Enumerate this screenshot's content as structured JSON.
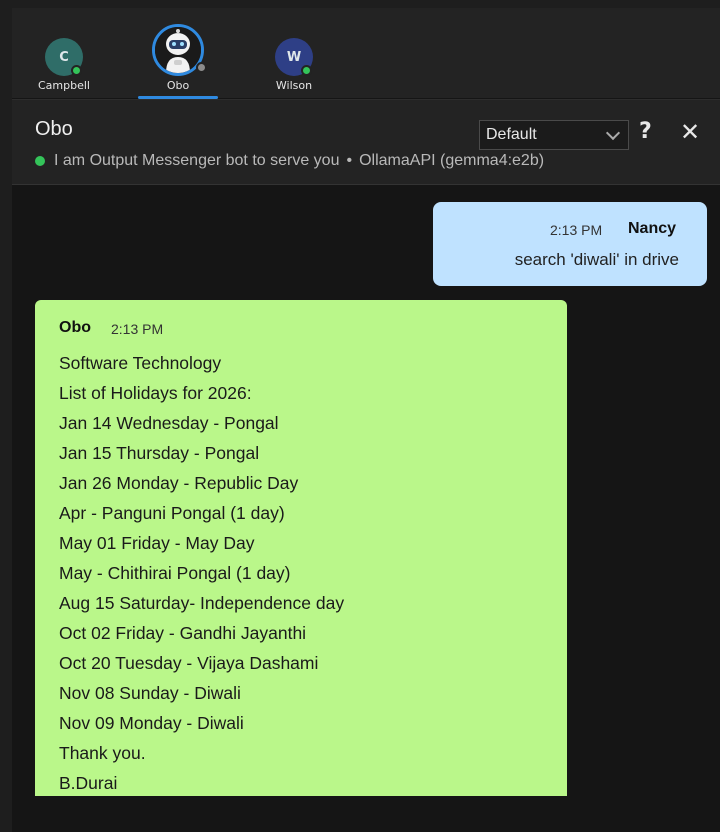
{
  "tabs": [
    {
      "name": "Campbell",
      "initial": "C",
      "status": "online"
    },
    {
      "name": "Obo",
      "status": "away"
    },
    {
      "name": "Wilson",
      "initial": "W",
      "status": "online"
    }
  ],
  "header": {
    "title": "Obo",
    "status_text": "I am Output Messenger bot to serve you",
    "separator": "•",
    "model": "OllamaAPI (gemma4:e2b)",
    "select_value": "Default",
    "help": "?",
    "close": "✕"
  },
  "messages": {
    "outgoing": {
      "time": "2:13 PM",
      "sender": "Nancy",
      "text": "search 'diwali' in drive"
    },
    "incoming": {
      "sender": "Obo",
      "time": "2:13 PM",
      "lines": [
        "Software Technology",
        "List of Holidays for 2026:",
        "Jan 14 Wednesday - Pongal",
        "Jan 15 Thursday - Pongal",
        "Jan 26 Monday - Republic Day",
        "Apr - Panguni Pongal (1 day)",
        "May 01 Friday - May Day",
        "May - Chithirai Pongal (1 day)",
        "Aug 15 Saturday- Independence day",
        "Oct 02 Friday - Gandhi Jayanthi",
        "Oct 20 Tuesday - Vijaya Dashami",
        "Nov 08 Sunday - Diwali",
        "Nov 09 Monday - Diwali",
        "Thank you.",
        "B.Durai"
      ]
    }
  },
  "colors": {
    "accent": "#2f8ae0",
    "online": "#34c45a",
    "outgoing_bubble": "#bfe2ff",
    "incoming_bubble": "#baf78a"
  }
}
